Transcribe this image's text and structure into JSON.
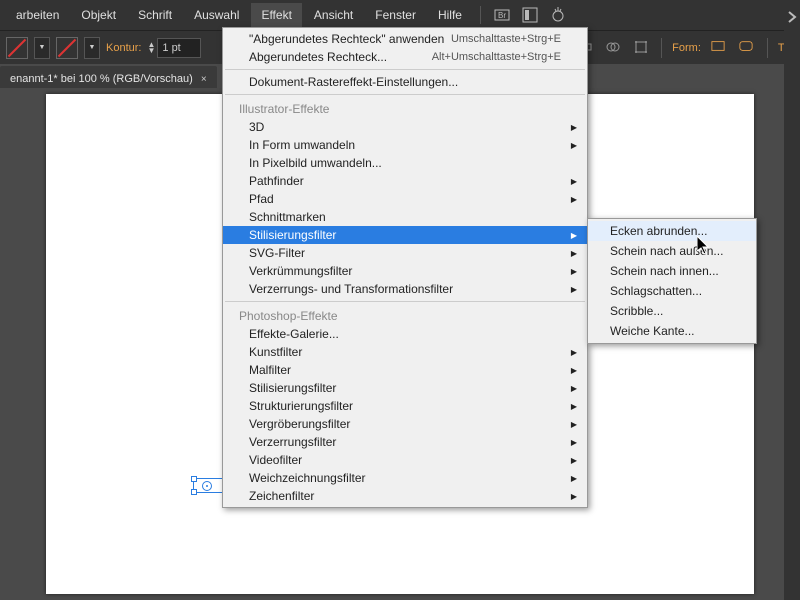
{
  "menubar": {
    "items": [
      "arbeiten",
      "Objekt",
      "Schrift",
      "Auswahl",
      "Effekt",
      "Ansicht",
      "Fenster",
      "Hilfe"
    ],
    "active_index": 4
  },
  "toolbar": {
    "kontur_label": "Kontur:",
    "stroke_value": "1 pt",
    "form_label": "Form:",
    "tr_label": "Tra"
  },
  "tab": {
    "title": "enannt-1* bei 100 % (RGB/Vorschau)"
  },
  "dropdown": {
    "top_items": [
      {
        "label": "\"Abgerundetes Rechteck\" anwenden",
        "shortcut": "Umschalttaste+Strg+E"
      },
      {
        "label": "Abgerundetes Rechteck...",
        "shortcut": "Alt+Umschalttaste+Strg+E"
      }
    ],
    "doc_raster": "Dokument-Rastereffekt-Einstellungen...",
    "section_ill": "Illustrator-Effekte",
    "ill_items": [
      {
        "label": "3D",
        "sub": true
      },
      {
        "label": "In Form umwandeln",
        "sub": true
      },
      {
        "label": "In Pixelbild umwandeln...",
        "sub": false
      },
      {
        "label": "Pathfinder",
        "sub": true
      },
      {
        "label": "Pfad",
        "sub": true
      },
      {
        "label": "Schnittmarken",
        "sub": false
      },
      {
        "label": "Stilisierungsfilter",
        "sub": true,
        "highlight": true
      },
      {
        "label": "SVG-Filter",
        "sub": true
      },
      {
        "label": "Verkrümmungsfilter",
        "sub": true
      },
      {
        "label": "Verzerrungs- und Transformationsfilter",
        "sub": true
      }
    ],
    "section_ps": "Photoshop-Effekte",
    "ps_items": [
      {
        "label": "Effekte-Galerie...",
        "sub": false
      },
      {
        "label": "Kunstfilter",
        "sub": true
      },
      {
        "label": "Malfilter",
        "sub": true
      },
      {
        "label": "Stilisierungsfilter",
        "sub": true
      },
      {
        "label": "Strukturierungsfilter",
        "sub": true
      },
      {
        "label": "Vergröberungsfilter",
        "sub": true
      },
      {
        "label": "Verzerrungsfilter",
        "sub": true
      },
      {
        "label": "Videofilter",
        "sub": true
      },
      {
        "label": "Weichzeichnungsfilter",
        "sub": true
      },
      {
        "label": "Zeichenfilter",
        "sub": true
      }
    ]
  },
  "submenu": {
    "items": [
      {
        "label": "Ecken abrunden...",
        "highlight": true
      },
      {
        "label": "Schein nach außen...",
        "highlight": false
      },
      {
        "label": "Schein nach innen...",
        "highlight": false
      },
      {
        "label": "Schlagschatten...",
        "highlight": false
      },
      {
        "label": "Scribble...",
        "highlight": false
      },
      {
        "label": "Weiche Kante...",
        "highlight": false
      }
    ]
  }
}
